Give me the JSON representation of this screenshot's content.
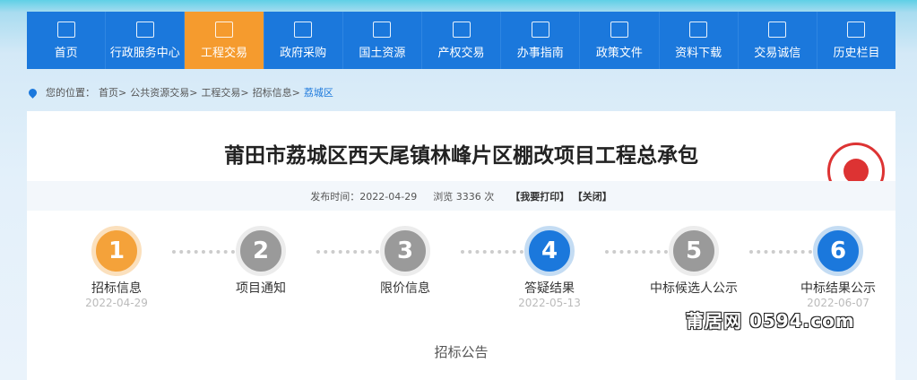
{
  "nav": [
    "首页",
    "行政服务中心",
    "工程交易",
    "政府采购",
    "国土资源",
    "产权交易",
    "办事指南",
    "政策文件",
    "资料下载",
    "交易诚信",
    "历史栏目"
  ],
  "nav_icons": [
    "home-icon",
    "bank-icon",
    "barrier-icon",
    "cart-icon",
    "land-icon",
    "document-icon",
    "signpost-icon",
    "policy-icon",
    "download-icon",
    "shield-icon",
    "monitor-icon"
  ],
  "breadcrumb": {
    "label": "您的位置：",
    "items": [
      "首页>",
      "公共资源交易>",
      "工程交易>",
      "招标信息>"
    ],
    "current": "荔城区"
  },
  "title": "莆田市荔城区西天尾镇林峰片区棚改项目工程总承包",
  "meta": {
    "publish": "发布时间：2022-04-29",
    "views": "浏览 3336 次",
    "print": "【我要打印】",
    "close": "【关闭】"
  },
  "steps": [
    {
      "num": "1",
      "label": "招标信息",
      "date": "2022-04-29"
    },
    {
      "num": "2",
      "label": "项目通知",
      "date": ""
    },
    {
      "num": "3",
      "label": "限价信息",
      "date": ""
    },
    {
      "num": "4",
      "label": "答疑结果",
      "date": "2022-05-13"
    },
    {
      "num": "5",
      "label": "中标候选人公示",
      "date": ""
    },
    {
      "num": "6",
      "label": "中标结果公示",
      "date": "2022-06-07"
    }
  ],
  "notice_title": "招标公告",
  "watermark": "莆居网 0594.com"
}
